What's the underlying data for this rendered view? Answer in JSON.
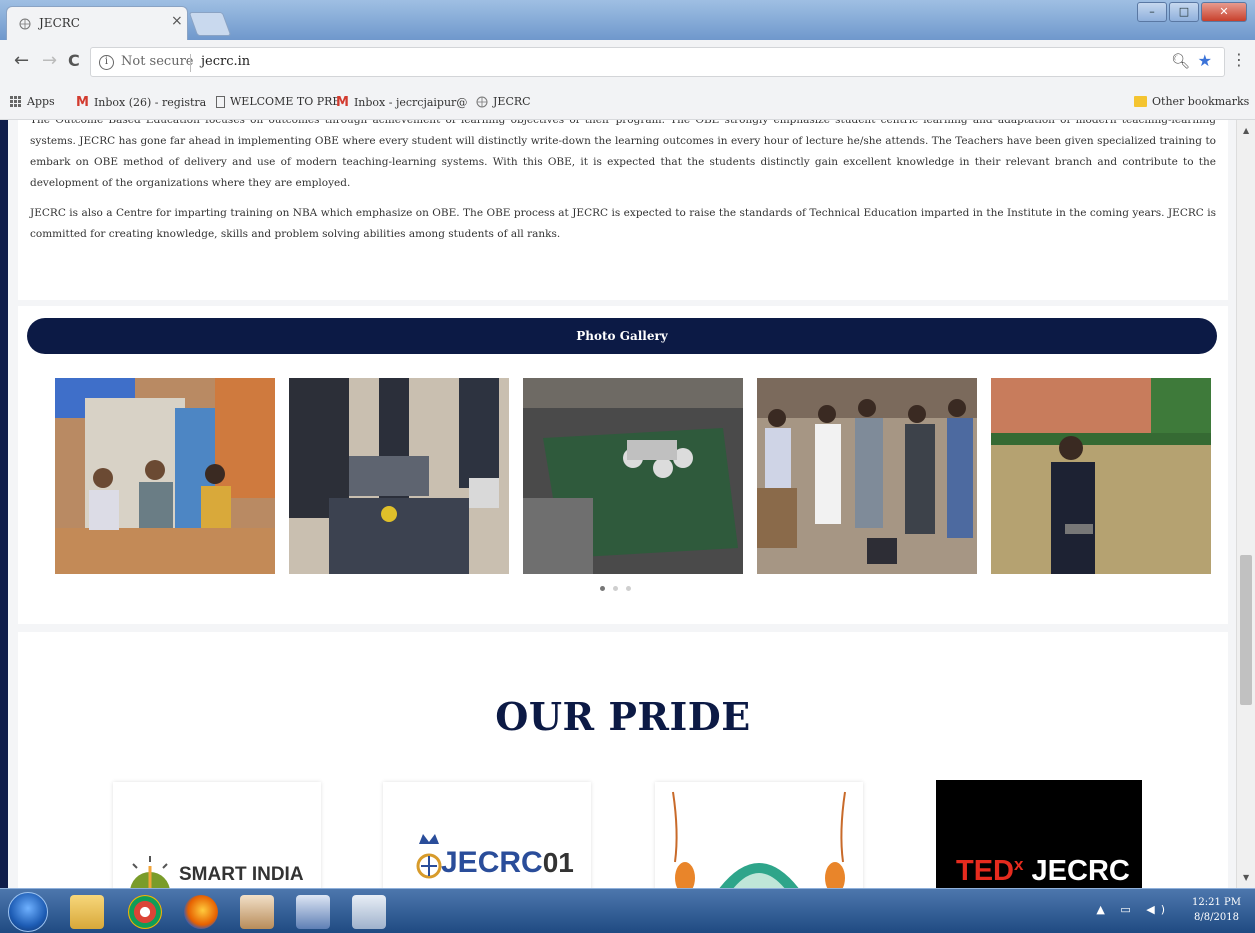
{
  "browser": {
    "tab_title": "JECRC",
    "tab_close": "×",
    "back": "←",
    "forward": "→",
    "reload": "C",
    "security_label": "Not secure",
    "url": "jecrc.in",
    "window_controls": {
      "minimize": "–",
      "maximize": "□",
      "close": "✕"
    },
    "bookmarks": [
      {
        "label": "Apps",
        "icon": "apps-grid-icon"
      },
      {
        "label": "Inbox (26) - registra",
        "icon": "gmail-icon"
      },
      {
        "label": "WELCOME TO PRE",
        "icon": "document-icon"
      },
      {
        "label": "Inbox - jecrcjaipur@",
        "icon": "gmail-icon"
      },
      {
        "label": "JECRC",
        "icon": "globe-icon"
      }
    ],
    "other_bookmarks": "Other bookmarks"
  },
  "content": {
    "paragraph1": "The Outcome Based Education focuses on outcomes through achievement of learning objectives of their program. The OBE strongly emphasize student centric learning and adaptation of modern teaching-learning systems. JECRC has gone far ahead in implementing OBE where every student will distinctly write-down the learning outcomes in every hour of lecture he/she attends. The Teachers have been given specialized training to embark on OBE method of delivery and use of modern teaching-learning systems. With this OBE, it is expected that the students distinctly gain excellent knowledge in their relevant branch and contribute to the development of the organizations where they are employed.",
    "paragraph2": "JECRC is also a Centre for imparting training on NBA which emphasize on OBE. The OBE process at JECRC is expected to raise the standards of Technical Education imparted in the Institute in the coming years. JECRC is committed for creating knowledge, skills and problem solving abilities among students of all ranks."
  },
  "gallery": {
    "title": "Photo Gallery",
    "photos": [
      "photo-1",
      "photo-2",
      "photo-3",
      "photo-4",
      "photo-5"
    ],
    "dots": 3,
    "active_dot": 0
  },
  "pride": {
    "title": "OUR PRIDE",
    "logos": [
      {
        "label": "SMART INDIA"
      },
      {
        "label": "JECRC",
        "suffix": "01"
      },
      {
        "label": ""
      },
      {
        "label_main": "JECRC",
        "label_ted": "TED",
        "label_x": "x"
      }
    ]
  },
  "taskbar": {
    "time": "12:21 PM",
    "date": "8/8/2018"
  },
  "colors": {
    "navy": "#0c1a45",
    "gmail_red": "#d23b2f",
    "tedx_red": "#e62b1e",
    "jecrc_blue": "#2a4d9a"
  }
}
